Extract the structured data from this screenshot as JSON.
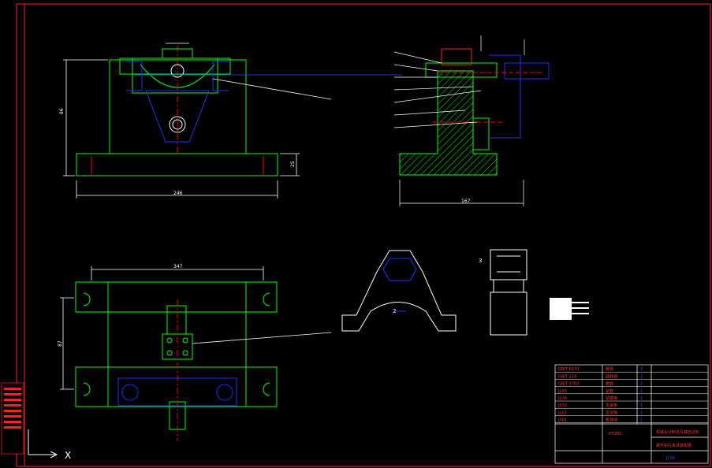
{
  "colors": {
    "background": "#000000",
    "frame": "#ff2020",
    "part": "#00ff00",
    "blue": "#2030ff",
    "white": "#ffffff",
    "centerline": "#ff0000",
    "hatch": "#00ff00",
    "titleblock_text_red": "#ff3030",
    "titleblock_text_blue": "#3050ff"
  },
  "labels": {
    "front_width_dim": "246",
    "front_height_dim": "86",
    "front_base_dim": "25",
    "side_width_dim": "167",
    "plan_top_dim": "347",
    "plan_height_dim": "87",
    "part_callout": "2",
    "side_callout": "3",
    "ucs_x": "X"
  },
  "bom_rows": [
    {
      "code": "GB/T 6170",
      "name": "螺母",
      "qty": "1"
    },
    {
      "code": "GB/T 119",
      "name": "圆柱销",
      "qty": "2"
    },
    {
      "code": "GB/T 5783",
      "name": "螺栓",
      "qty": "2"
    },
    {
      "code": "JJ-05",
      "name": "钻套",
      "qty": "1"
    },
    {
      "code": "JJ-04",
      "name": "钻模板",
      "qty": "1"
    },
    {
      "code": "JJ-03",
      "name": "支承板",
      "qty": "1"
    },
    {
      "code": "JJ-02",
      "name": "定位销",
      "qty": "1"
    },
    {
      "code": "JJ-01",
      "name": "夹具体",
      "qty": "1"
    }
  ],
  "title_block": {
    "school": "机械设计制造及其自动化",
    "drawing_title": "拨叉钻孔夹具装配图",
    "material": "HT200",
    "drawing_no": "JJ-00"
  }
}
